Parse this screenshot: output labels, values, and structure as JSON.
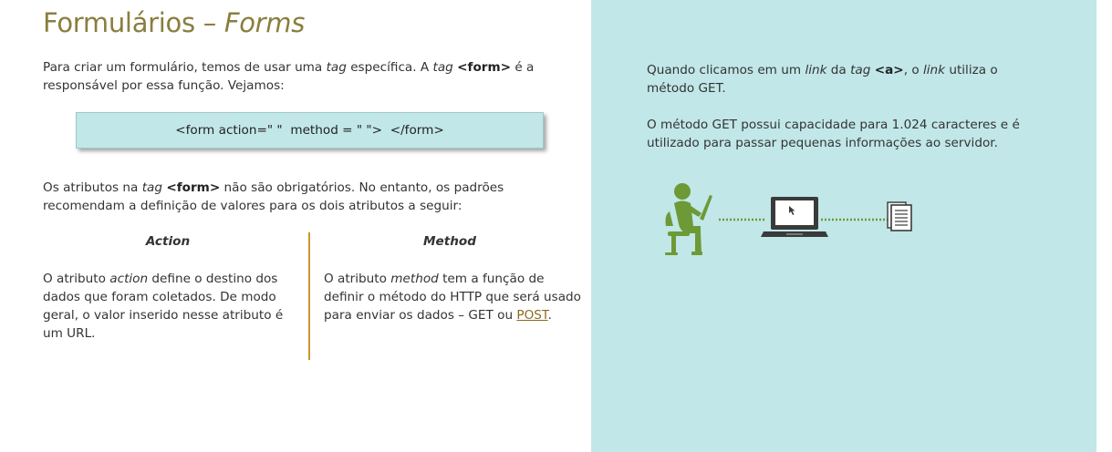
{
  "title": {
    "main": "Formulários – ",
    "italic": "Forms"
  },
  "intro": {
    "t1": "Para criar um formulário, temos de usar uma ",
    "tag1": "tag",
    "t2": " específica. A ",
    "tag2": "tag",
    "t3": " ",
    "form_tag": "<form>",
    "t4": " é a responsável por essa função. Vejamos:"
  },
  "code_example": "<form action=\" \"  method = \" \">  </form>",
  "attributes_para": {
    "t1": "Os atributos na ",
    "tag": "tag",
    "t2": " ",
    "form_tag": "<form>",
    "t3": " não são obrigatórios. No entanto, os padrões recomendam a definição de valores para os dois atributos a seguir:"
  },
  "columns": {
    "action": {
      "header": "Action",
      "t1": "O atributo ",
      "attr": "action",
      "t2": " define o destino dos dados que foram coletados. De modo geral, o valor inserido nesse atributo é um URL."
    },
    "method": {
      "header": "Method",
      "t1": "O atributo ",
      "attr": "method",
      "t2": " tem a função de definir o método do HTTP que será usado para enviar os dados – GET ou ",
      "link": "POST",
      "t3": "."
    }
  },
  "side_panel": {
    "p1": {
      "t1": "Quando clicamos em um ",
      "link": "link",
      "t2": " da ",
      "tag": "tag",
      "t3": " ",
      "a_tag": "<a>",
      "t4": ", o ",
      "link2": "link",
      "t5": " utiliza o método GET."
    },
    "p2": "O método GET possui capacidade para 1.024 caracteres e é utilizado para passar pequenas informações ao servidor."
  },
  "colors": {
    "title": "#8a7e3e",
    "panel_bg": "#c1e7e8",
    "divider": "#c9962e",
    "person_green": "#6d9a37",
    "device_dark": "#3a3a3a"
  },
  "icons": [
    "person-at-computer-icon",
    "laptop-icon",
    "document-stack-icon"
  ]
}
